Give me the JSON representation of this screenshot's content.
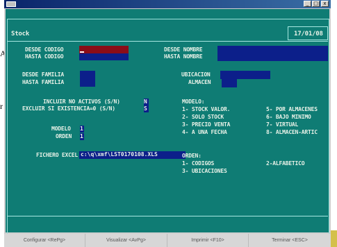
{
  "stray_text": {
    "top": "A.",
    "mid": "r"
  },
  "window": {
    "title_icon": "app-icon",
    "buttons": [
      "_",
      "□",
      "x"
    ]
  },
  "header": {
    "title": "Stock",
    "date": "17/01/08"
  },
  "filters": {
    "desde_codigo": "DESDE CODIGO",
    "hasta_codigo": "HASTA CODIGO",
    "desde_nombre": "DESDE NOMBRE",
    "hasta_nombre": "HASTA NOMBRE",
    "desde_familia": "DESDE FAMILIA",
    "hasta_familia": "HASTA FAMILIA",
    "ubicacion": "UBICACION",
    "almacen": "ALMACEN",
    "incluir_no_activos": "INCLUIR NO ACTIVOS (S/N)",
    "incluir_value": "N",
    "excluir_existencia": "EXCLUIR SI EXISTENCIA=0 (S/N)",
    "excluir_value": "S",
    "modelo": "MODELO",
    "modelo_value": "1",
    "orden": "ORDEN",
    "orden_value": "1",
    "fichero_excel": "FICHERO EXCEL",
    "fichero_value": "c:\\q\\xmf\\LST0170108.XLS"
  },
  "modelo_list": {
    "title": "MODELO:",
    "items": [
      "1- STOCK VALOR.",
      "2- SOLO STOCK",
      "3- PRECIO VENTA",
      "4- A UNA FECHA",
      "5- POR ALMACENES",
      "6- BAJO MINIMO",
      "7- VIRTUAL",
      "8- ALMACEN-ARTIC"
    ]
  },
  "orden_list": {
    "title": "ORDEN:",
    "items": [
      "1- CODIGOS",
      "2-ALFABETICO",
      "3- UBICACIONES"
    ]
  },
  "fkeys": [
    "Configurar <RePg>",
    "Visualizar <AvPg>",
    "Imprimir <F10>",
    "Terminar <ESC>"
  ],
  "colors": {
    "screen": "#0f7c74",
    "field_red": "#8b0d18",
    "field_blue": "#0c1f8a",
    "text": "#e8f2e8"
  }
}
